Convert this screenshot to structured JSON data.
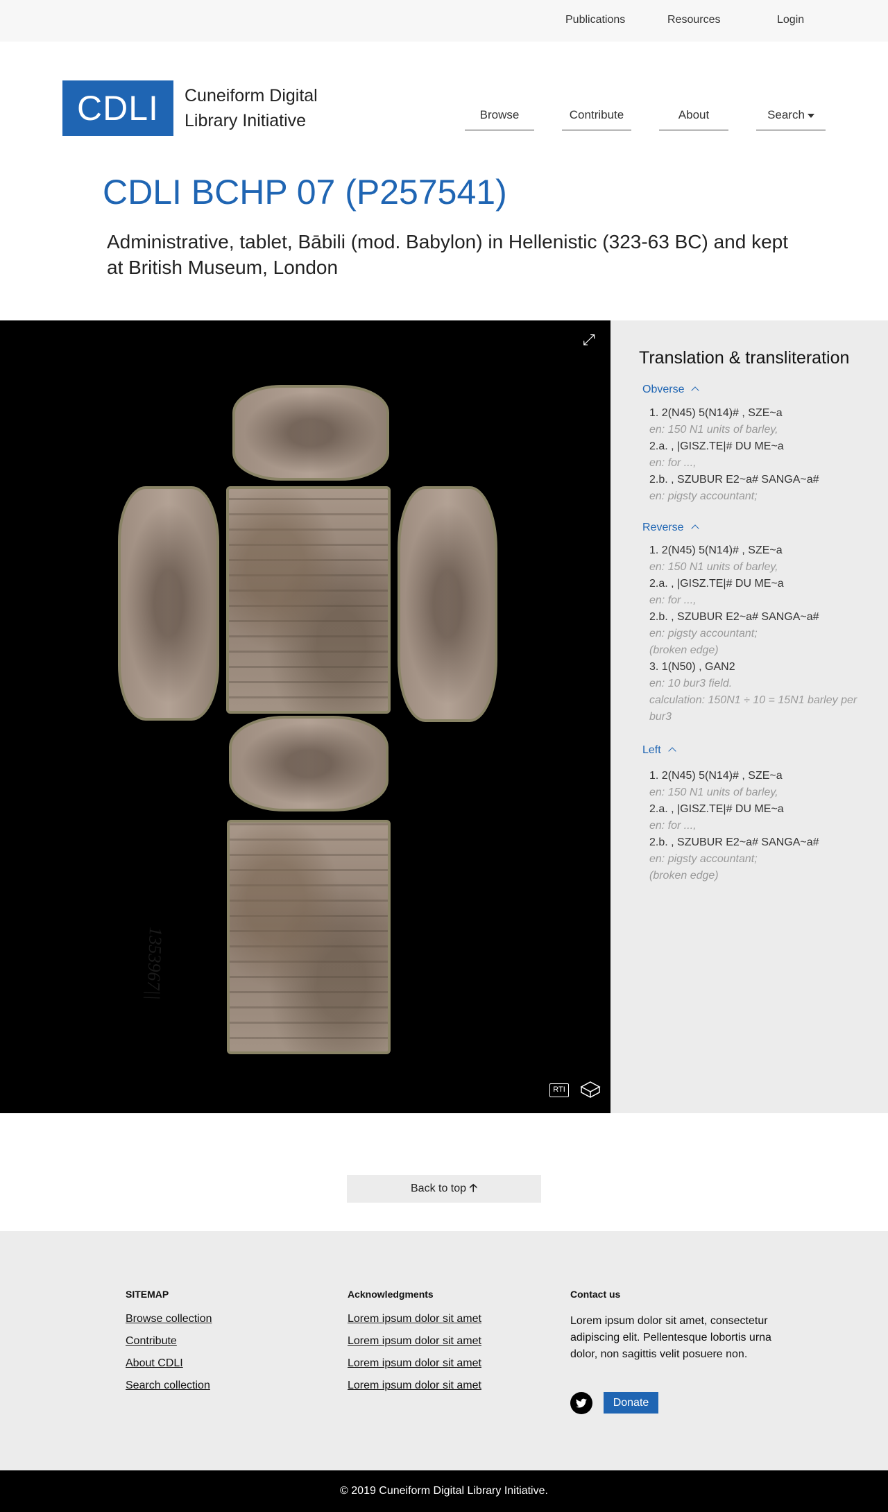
{
  "topbar": {
    "publications": "Publications",
    "resources": "Resources",
    "login": "Login"
  },
  "logo": {
    "box": "CDLI",
    "line1": "Cuneiform Digital",
    "line2": "Library Initiative"
  },
  "nav": {
    "browse": "Browse",
    "contribute": "Contribute",
    "about": "About",
    "search": "Search"
  },
  "title": "CDLI BCHP 07 (P257541)",
  "subtitle": "Administrative, tablet, Bābili (mod. Babylon) in Hellenistic (323-63 BC) and kept at British Museum, London",
  "viewer": {
    "museum_number": "1353967||",
    "rti": "RTI"
  },
  "panel": {
    "title": "Translation & transliteration",
    "obverse": {
      "heading": "Obverse",
      "lines": [
        "1. 2(N45) 5(N14)# , SZE~a",
        "en: 150 N1 units of barley,",
        "2.a. , |GISZ.TE|# DU ME~a",
        "en: for ...,",
        "2.b. , SZUBUR E2~a# SANGA~a#",
        "en: pigsty accountant;"
      ]
    },
    "reverse": {
      "heading": "Reverse",
      "lines": [
        "1. 2(N45) 5(N14)# , SZE~a",
        "en: 150 N1 units of barley,",
        "2.a. , |GISZ.TE|# DU ME~a",
        "en: for ...,",
        "2.b. , SZUBUR E2~a# SANGA~a#",
        "en: pigsty accountant;",
        "(broken edge)",
        "3. 1(N50) , GAN2",
        "en: 10 bur3 field.",
        "calculation: 150N1 ÷ 10 = 15N1 barley per",
        "bur3"
      ]
    },
    "left": {
      "heading": "Left",
      "lines": [
        "1. 2(N45) 5(N14)# , SZE~a",
        "en: 150 N1 units of barley,",
        "2.a. , |GISZ.TE|# DU ME~a",
        "en: for ...,",
        "2.b. , SZUBUR E2~a# SANGA~a#",
        "en: pigsty accountant;",
        "(broken edge)"
      ]
    }
  },
  "back_to_top": "Back to top",
  "footer": {
    "sitemap": {
      "heading": "SITEMAP",
      "links": [
        "Browse collection",
        "Contribute",
        "About CDLI",
        "Search collection"
      ]
    },
    "ack": {
      "heading": "Acknowledgments",
      "links": [
        "Lorem ipsum dolor sit amet",
        "Lorem ipsum dolor sit amet",
        "Lorem ipsum dolor sit amet",
        "Lorem ipsum dolor sit amet"
      ]
    },
    "contact": {
      "heading": "Contact us",
      "text": "Lorem ipsum dolor sit amet, consectetur adipiscing elit. Pellentesque lobortis urna dolor, non sagittis velit posuere non.",
      "donate": "Donate"
    }
  },
  "copyright": "© 2019 Cuneiform Digital Library Initiative.",
  "colors": {
    "accent": "#1f65b3",
    "panel_bg": "#ececec",
    "viewer_bg": "#000000"
  }
}
